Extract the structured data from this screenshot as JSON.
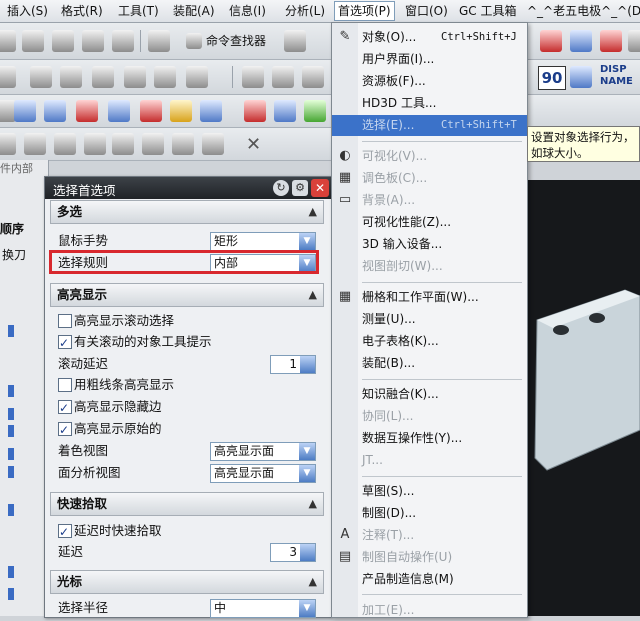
{
  "menubar": {
    "items": [
      "插入(S)",
      "格式(R)",
      "工具(T)",
      "装配(A)",
      "信息(I)",
      "分析(L)",
      "首选项(P)",
      "窗口(O)",
      "GC 工具箱",
      "^_^老五电极^_^(D)"
    ],
    "active_index": 6
  },
  "toolbar": {
    "command_finder_label": "命令查找器",
    "badge_90": "90",
    "disp_label_1": "DISP",
    "disp_label_2": "NAME"
  },
  "left_strip": {
    "header_1": "顺序",
    "header_2": "换刀",
    "tab_label": "件内部"
  },
  "dialog": {
    "title": "选择首选项",
    "sections": [
      {
        "title": "多选",
        "rows": [
          {
            "label": "鼠标手势",
            "type": "select",
            "value": "矩形"
          },
          {
            "label": "选择规则",
            "type": "select",
            "value": "内部"
          }
        ]
      },
      {
        "title": "高亮显示",
        "rows": [
          {
            "label": "高亮显示滚动选择",
            "type": "checkbox",
            "checked": false
          },
          {
            "label": "有关滚动的对象工具提示",
            "type": "checkbox",
            "checked": true
          },
          {
            "label": "滚动延迟",
            "type": "spinner",
            "value": "1"
          },
          {
            "label": "用粗线条高亮显示",
            "type": "checkbox",
            "checked": false
          },
          {
            "label": "高亮显示隐藏边",
            "type": "checkbox",
            "checked": true
          },
          {
            "label": "高亮显示原始的",
            "type": "checkbox",
            "checked": true
          },
          {
            "label": "着色视图",
            "type": "select",
            "value": "高亮显示面"
          },
          {
            "label": "面分析视图",
            "type": "select",
            "value": "高亮显示面"
          }
        ]
      },
      {
        "title": "快速拾取",
        "rows": [
          {
            "label": "延迟时快速拾取",
            "type": "checkbox",
            "checked": true
          },
          {
            "label": "延迟",
            "type": "spinner",
            "value": "3"
          }
        ]
      },
      {
        "title": "光标",
        "rows": [
          {
            "label": "选择半径",
            "type": "select",
            "value": "中"
          }
        ]
      }
    ]
  },
  "preferences_menu": {
    "items": [
      {
        "label": "对象(O)...",
        "shortcut": "Ctrl+Shift+J",
        "icon": "object-icon",
        "state": "normal"
      },
      {
        "label": "用户界面(I)...",
        "shortcut": "",
        "icon": "",
        "state": "normal"
      },
      {
        "label": "资源板(F)...",
        "shortcut": "",
        "icon": "",
        "state": "normal"
      },
      {
        "label": "HD3D 工具...",
        "shortcut": "",
        "icon": "",
        "state": "normal"
      },
      {
        "label": "选择(E)...",
        "shortcut": "Ctrl+Shift+T",
        "icon": "",
        "state": "highlighted"
      },
      {
        "label": "可视化(V)...",
        "shortcut": "",
        "icon": "visualization-icon",
        "state": "disabled"
      },
      {
        "label": "调色板(C)...",
        "shortcut": "",
        "icon": "palette-icon",
        "state": "disabled"
      },
      {
        "label": "背景(A)...",
        "shortcut": "",
        "icon": "background-icon",
        "state": "disabled"
      },
      {
        "label": "可视化性能(Z)...",
        "shortcut": "",
        "icon": "",
        "state": "normal"
      },
      {
        "label": "3D 输入设备...",
        "shortcut": "",
        "icon": "",
        "state": "normal"
      },
      {
        "label": "视图剖切(W)...",
        "shortcut": "",
        "icon": "",
        "state": "disabled"
      },
      {
        "label": "栅格和工作平面(W)...",
        "shortcut": "",
        "icon": "grid-icon",
        "state": "normal"
      },
      {
        "label": "测量(U)...",
        "shortcut": "",
        "icon": "",
        "state": "normal"
      },
      {
        "label": "电子表格(K)...",
        "shortcut": "",
        "icon": "",
        "state": "normal"
      },
      {
        "label": "装配(B)...",
        "shortcut": "",
        "icon": "",
        "state": "normal"
      },
      {
        "label": "知识融合(K)...",
        "shortcut": "",
        "icon": "",
        "state": "normal"
      },
      {
        "label": "协同(L)...",
        "shortcut": "",
        "icon": "",
        "state": "disabled"
      },
      {
        "label": "数据互操作性(Y)...",
        "shortcut": "",
        "icon": "",
        "state": "normal"
      },
      {
        "label": "JT...",
        "shortcut": "",
        "icon": "",
        "state": "disabled"
      },
      {
        "label": "草图(S)...",
        "shortcut": "",
        "icon": "",
        "state": "normal"
      },
      {
        "label": "制图(D)...",
        "shortcut": "",
        "icon": "",
        "state": "normal"
      },
      {
        "label": "注释(T)...",
        "shortcut": "",
        "icon": "annotation-icon",
        "state": "disabled"
      },
      {
        "label": "制图自动操作(U)",
        "shortcut": "",
        "icon": "drafting-automation-icon",
        "state": "disabled"
      },
      {
        "label": "产品制造信息(M)",
        "shortcut": "",
        "icon": "",
        "state": "normal"
      },
      {
        "label": "加工(E)...",
        "shortcut": "",
        "icon": "",
        "state": "disabled"
      }
    ]
  },
  "tooltip": {
    "text": "设置对象选择行为，如球大小。"
  },
  "colors": {
    "highlight": "#3b72c9",
    "annotation_box": "#d8282e",
    "dialog_title": "#2a2e33"
  }
}
